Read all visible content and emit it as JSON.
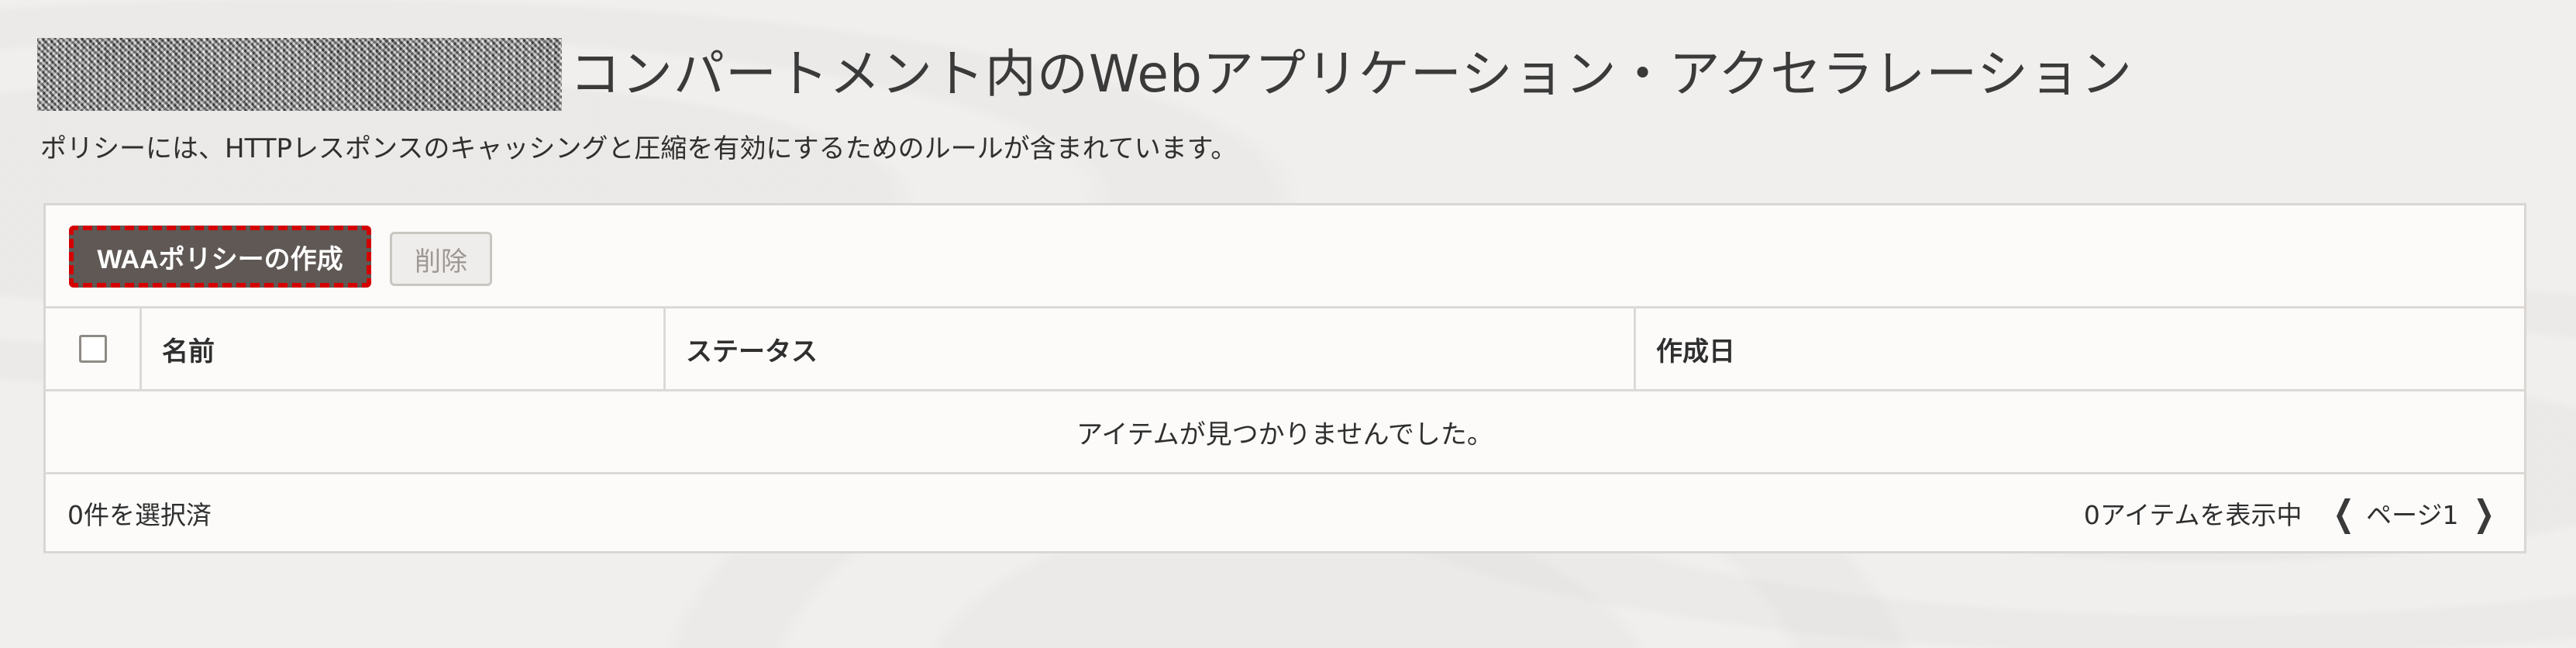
{
  "header": {
    "title": "コンパートメント内のWebアプリケーション・アクセラレーション"
  },
  "description": "ポリシーには、HTTPレスポンスのキャッシングと圧縮を有効にするためのルールが含まれています。",
  "toolbar": {
    "create_label": "WAAポリシーの作成",
    "delete_label": "削除"
  },
  "table": {
    "columns": [
      "名前",
      "ステータス",
      "作成日"
    ],
    "empty_message": "アイテムが見つかりませんでした。"
  },
  "footer": {
    "selected": "0件を選択済",
    "items_count": "0アイテムを表示中",
    "page_label": "ページ1"
  },
  "icons": {
    "prev": "chevron-left-icon",
    "next": "chevron-right-icon"
  },
  "colors": {
    "primary_button_bg": "#5f5854",
    "focus_outline": "#d40000",
    "background": "#f1efed"
  }
}
